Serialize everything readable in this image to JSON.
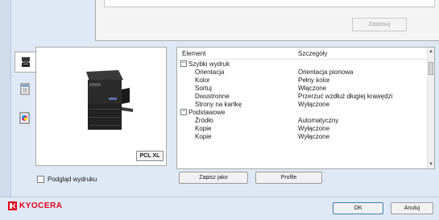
{
  "top": {
    "apply_label": "Zastosuj"
  },
  "tabs": [
    {
      "name": "printer-tab",
      "icon": "printer-icon"
    },
    {
      "name": "document-tab",
      "icon": "document-icon"
    },
    {
      "name": "color-tab",
      "icon": "color-icon"
    }
  ],
  "preview": {
    "badge": "PCL XL"
  },
  "details": {
    "header": {
      "element": "Element",
      "details": "Szczegóły"
    },
    "rows": [
      {
        "type": "group",
        "label": "Szybki wydruk",
        "value": ""
      },
      {
        "type": "item",
        "label": "Orientacja",
        "value": "Orientacja pionowa"
      },
      {
        "type": "item",
        "label": "Kolor",
        "value": "Pełny kolor"
      },
      {
        "type": "item",
        "label": "Sortuj",
        "value": "Włączone"
      },
      {
        "type": "item",
        "label": "Dwustronne",
        "value": "Przerzuć wzdłuż długiej krawędzi"
      },
      {
        "type": "item",
        "label": "Strony na kartkę",
        "value": "Wyłączone"
      },
      {
        "type": "group",
        "label": "Podstawowe",
        "value": ""
      },
      {
        "type": "item",
        "label": "Źródło",
        "value": "Automatyczny"
      },
      {
        "type": "item",
        "label": "Kopie",
        "value": "Wyłączone"
      },
      {
        "type": "item",
        "label": "Kopie",
        "value": "Wyłączone"
      }
    ]
  },
  "buttons": {
    "save_as": "Zapisz jako",
    "profile": "Profile",
    "ok": "OK",
    "cancel": "Anuluj"
  },
  "preview_checkbox": {
    "label": "Podgląd wydruku",
    "checked": false
  },
  "brand": {
    "name": "KYOCERA",
    "color": "#e3001b"
  }
}
